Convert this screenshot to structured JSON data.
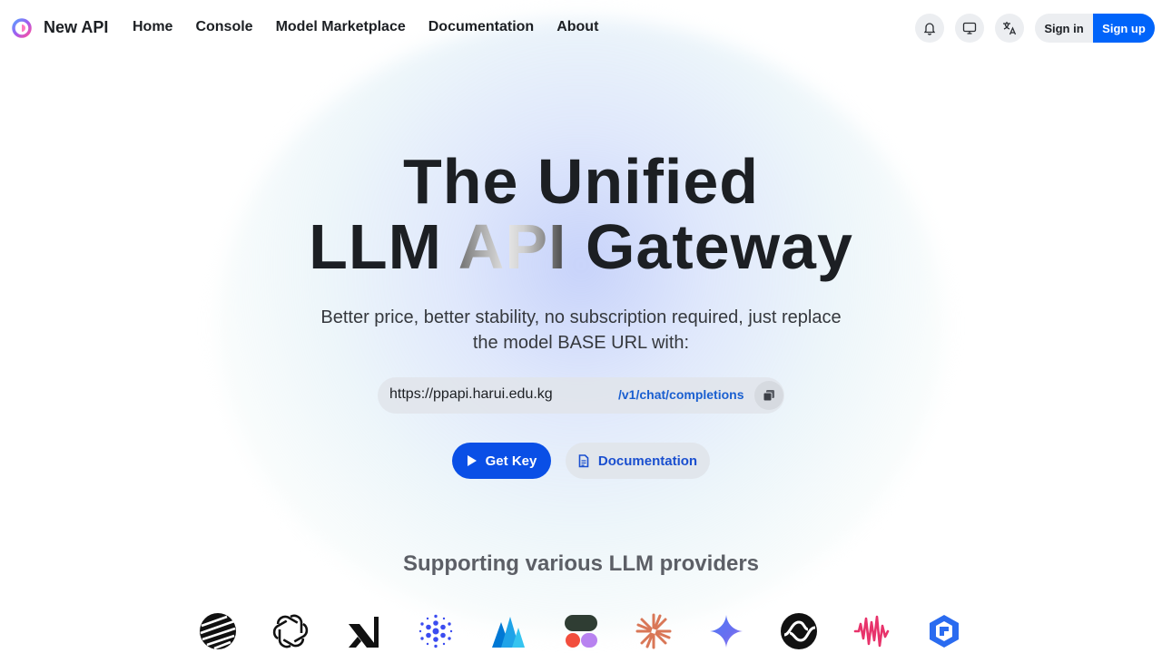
{
  "header": {
    "brand": "New API",
    "nav": [
      "Home",
      "Console",
      "Model Marketplace",
      "Documentation",
      "About"
    ],
    "icons": [
      "bell-icon",
      "monitor-icon",
      "translate-icon"
    ],
    "signin_label": "Sign in",
    "signup_label": "Sign up"
  },
  "hero": {
    "title_line1": "The Unified",
    "title_line2_a": "LLM ",
    "title_line2_b": "API",
    "title_line2_c": " Gateway",
    "subtitle": "Better price, better stability, no subscription required, just replace the model BASE URL with:",
    "base_url": "https://ppapi.harui.edu.kg",
    "endpoint": "/v1/chat/completions",
    "get_key_label": "Get Key",
    "docs_label": "Documentation"
  },
  "providers": {
    "title": "Supporting various LLM providers",
    "icons": [
      "moonshot-icon",
      "openai-icon",
      "xai-icon",
      "cohere-dots-icon",
      "azure-icon",
      "replicate-icon",
      "claude-icon",
      "gemini-icon",
      "suno-icon",
      "audio-wave-icon",
      "zhipu-icon"
    ]
  },
  "colors": {
    "primary": "#0064fa",
    "get_key": "#0a4fe6",
    "link": "#1a5fd0"
  }
}
